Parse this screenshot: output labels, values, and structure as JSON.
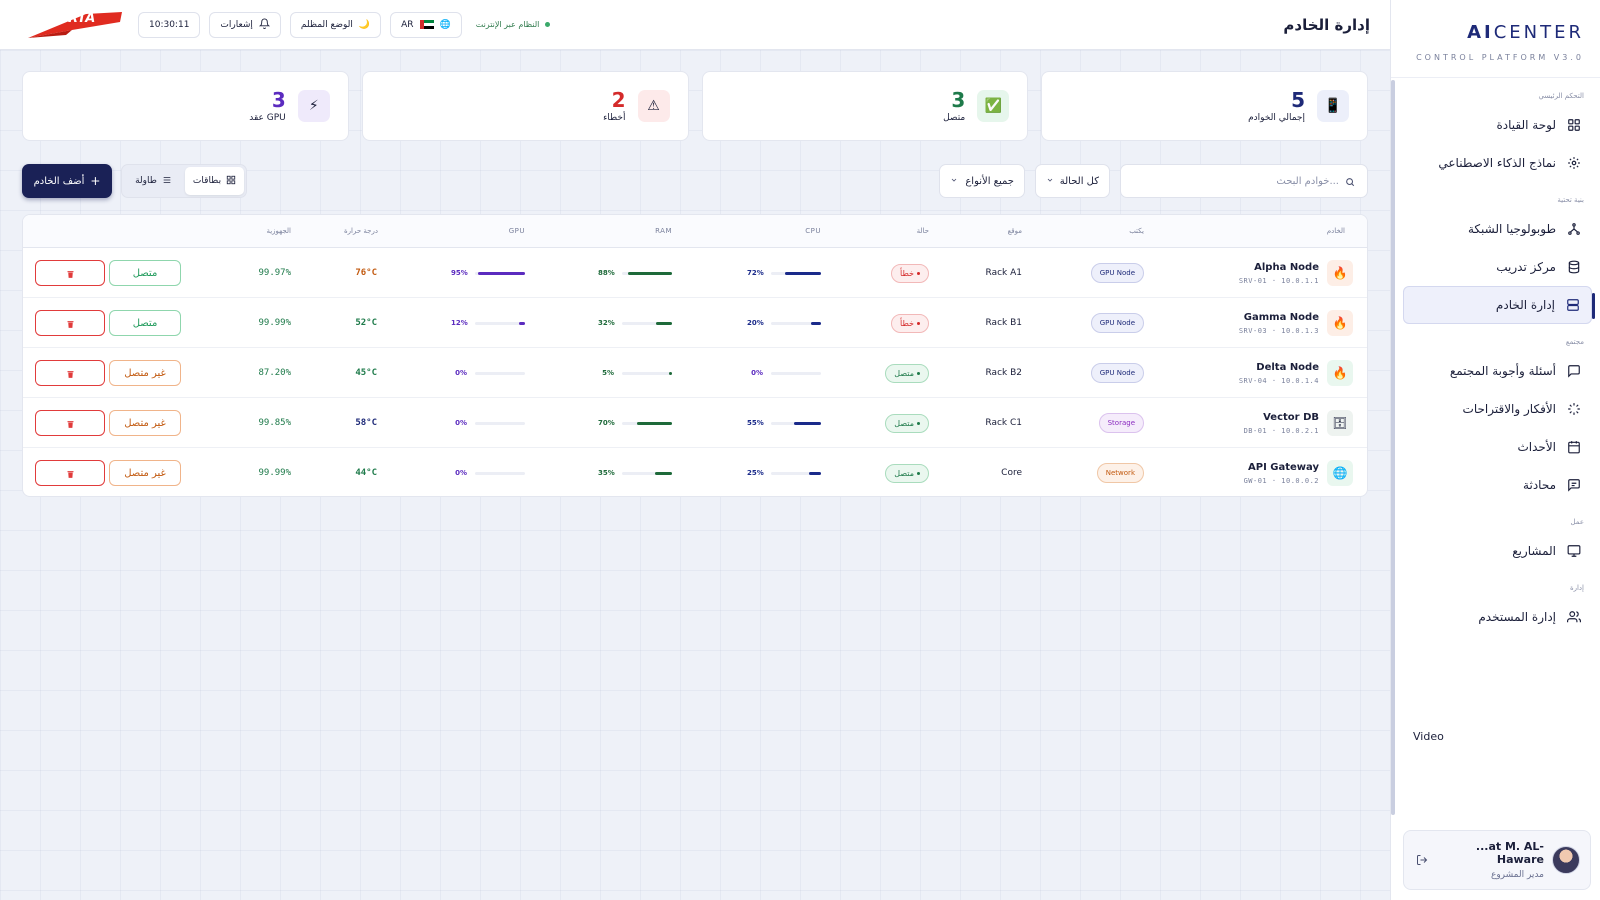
{
  "header": {
    "title": "إدارة الخادم",
    "logo_text": "RTA",
    "time": "10:30:11",
    "notifications_label": "إشعارات",
    "dark_mode_label": "الوضع المظلم",
    "dark_mode_icon": "🌙",
    "language": "AR",
    "language_icon": "🌐",
    "system_status": "النظام عبر الإنترنت"
  },
  "brand": {
    "title_bold": "AI",
    "title_rest": "CENTER",
    "subtitle": "CONTROL PLATFORM V3.0"
  },
  "sidebar": {
    "sections": [
      {
        "title": "التحكم الرئيسي",
        "items": [
          {
            "label": "لوحة القيادة",
            "icon": "grid-icon",
            "active": false
          },
          {
            "label": "نماذج الذكاء الاصطناعي",
            "icon": "sparkle-icon",
            "active": false
          }
        ]
      },
      {
        "title": "بنية تحتية",
        "items": [
          {
            "label": "طوبولوجيا الشبكة",
            "icon": "network-icon",
            "active": false
          },
          {
            "label": "مركز تدريب",
            "icon": "database-icon",
            "active": false
          },
          {
            "label": "إدارة الخادم",
            "icon": "server-icon",
            "active": true
          }
        ]
      },
      {
        "title": "مجتمع",
        "items": [
          {
            "label": "أسئلة وأجوبة المجتمع",
            "icon": "chat-icon",
            "active": false
          },
          {
            "label": "الأفكار والاقتراحات",
            "icon": "loader-icon",
            "active": false
          },
          {
            "label": "الأحداث",
            "icon": "calendar-icon",
            "active": false
          },
          {
            "label": "محادثة",
            "icon": "message-icon",
            "active": false
          }
        ]
      },
      {
        "title": "عمل",
        "items": [
          {
            "label": "المشاريع",
            "icon": "monitor-icon",
            "active": false
          }
        ]
      },
      {
        "title": "إدارة",
        "items": [
          {
            "label": "إدارة المستخدم",
            "icon": "users-icon",
            "active": false
          }
        ]
      }
    ],
    "video_label": "Video",
    "user": {
      "name": "...at M. AL-Haware",
      "role": "مدير المشروع"
    }
  },
  "stats": [
    {
      "value": "5",
      "label": "إجمالي الخوادم",
      "icon": "📱",
      "color": "#1e2a78",
      "bg": "#eceffa"
    },
    {
      "value": "3",
      "label": "متصل",
      "icon": "✅",
      "color": "#1e7a4a",
      "bg": "#e6f6ec"
    },
    {
      "value": "2",
      "label": "أخطاء",
      "icon": "⚠",
      "color": "#d42a2a",
      "bg": "#fdeaea"
    },
    {
      "value": "3",
      "label": "عقد GPU",
      "icon": "⚡",
      "color": "#5b2bbf",
      "bg": "#efeafb"
    }
  ],
  "toolbar": {
    "search_placeholder": "خوادم البحث...",
    "status_filter": "كل الحالة",
    "type_filter": "جميع الأنواع",
    "view_cards": "بطاقات",
    "view_table": "طاولة",
    "add_label": "أضف الخادم"
  },
  "table": {
    "headers": {
      "server": "الخادم",
      "type": "يكتب",
      "location": "موقع",
      "status": "حالة",
      "cpu": "CPU",
      "ram": "RAM",
      "gpu": "GPU",
      "temp": "درجة حرارة",
      "uptime": "الجهوزية"
    },
    "rows": [
      {
        "name": "Alpha Node",
        "sub": "SRV-01 · 10.0.1.1",
        "icon": "🔥",
        "icon_bg": "#fdeee6",
        "type": "GPU Node",
        "type_color": "#1e2a78",
        "type_bg": "#eef0fb",
        "type_border": "#c9cdea",
        "location": "Rack A1",
        "status": "خطأ",
        "status_color": "#d42a2a",
        "status_bg": "#fdeeee",
        "status_border": "#f2b8b8",
        "cpu": 72,
        "ram": 88,
        "gpu": 95,
        "temp": "76°C",
        "temp_color": "#c25a10",
        "uptime": "99.97%",
        "action": "متصل",
        "action_color": "#1e9a5a",
        "action_border": "#8fd6ad"
      },
      {
        "name": "Gamma Node",
        "sub": "SRV-03 · 10.0.1.3",
        "icon": "🔥",
        "icon_bg": "#fdeee6",
        "type": "GPU Node",
        "type_color": "#1e2a78",
        "type_bg": "#eef0fb",
        "type_border": "#c9cdea",
        "location": "Rack B1",
        "status": "خطأ",
        "status_color": "#d42a2a",
        "status_bg": "#fdeeee",
        "status_border": "#f2b8b8",
        "cpu": 20,
        "ram": 32,
        "gpu": 12,
        "temp": "52°C",
        "temp_color": "#1e7a4a",
        "uptime": "99.99%",
        "action": "متصل",
        "action_color": "#1e9a5a",
        "action_border": "#8fd6ad"
      },
      {
        "name": "Delta Node",
        "sub": "SRV-04 · 10.0.1.4",
        "icon": "🔥",
        "icon_bg": "#e9f7ef",
        "type": "GPU Node",
        "type_color": "#1e2a78",
        "type_bg": "#eef0fb",
        "type_border": "#c9cdea",
        "location": "Rack B2",
        "status": "متصل",
        "status_color": "#1e7a4a",
        "status_bg": "#eaf7ef",
        "status_border": "#a9dcbd",
        "cpu": 0,
        "ram": 5,
        "gpu": 0,
        "temp": "45°C",
        "temp_color": "#1e7a4a",
        "uptime": "87.20%",
        "action": "غير متصل",
        "action_color": "#c25a10",
        "action_border": "#f0b48a"
      },
      {
        "name": "Vector DB",
        "sub": "DB-01 · 10.0.2.1",
        "icon": "🗄",
        "icon_bg": "#eef3f0",
        "type": "Storage",
        "type_color": "#8a2bbf",
        "type_bg": "#f5ecfb",
        "type_border": "#dbc2ee",
        "location": "Rack C1",
        "status": "متصل",
        "status_color": "#1e7a4a",
        "status_bg": "#eaf7ef",
        "status_border": "#a9dcbd",
        "cpu": 55,
        "ram": 70,
        "gpu": 0,
        "temp": "58°C",
        "temp_color": "#1e2a78",
        "uptime": "99.85%",
        "action": "غير متصل",
        "action_color": "#c25a10",
        "action_border": "#f0b48a"
      },
      {
        "name": "API Gateway",
        "sub": "GW-01 · 10.0.0.2",
        "icon": "🌐",
        "icon_bg": "#e9f7ef",
        "type": "Network",
        "type_color": "#c25a10",
        "type_bg": "#fdf1e8",
        "type_border": "#f0c7a6",
        "location": "Core",
        "status": "متصل",
        "status_color": "#1e7a4a",
        "status_bg": "#eaf7ef",
        "status_border": "#a9dcbd",
        "cpu": 25,
        "ram": 35,
        "gpu": 0,
        "temp": "44°C",
        "temp_color": "#1e7a4a",
        "uptime": "99.99%",
        "action": "غير متصل",
        "action_color": "#c25a10",
        "action_border": "#f0b48a"
      }
    ],
    "bar_colors": {
      "cpu": "#1a2a8a",
      "ram": "#1e6a3a",
      "gpu": "#5b2bbf"
    }
  }
}
